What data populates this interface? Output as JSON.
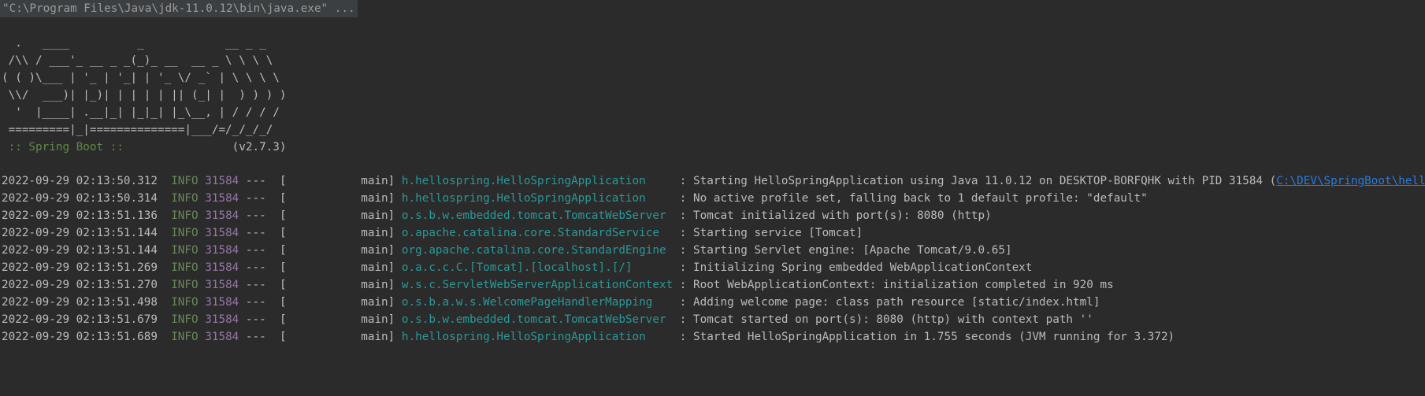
{
  "console": {
    "command": "\"C:\\Program Files\\Java\\jdk-11.0.12\\bin\\java.exe\" ...",
    "banner": [
      "  .   ____          _            __ _ _",
      " /\\\\ / ___'_ __ _ _(_)_ __  __ _ \\ \\ \\ \\",
      "( ( )\\___ | '_ | '_| | '_ \\/ _` | \\ \\ \\ \\",
      " \\\\/  ___)| |_)| | | | | || (_| |  ) ) ) )",
      "  '  |____| .__|_| |_|_| |_\\__, | / / / /",
      " =========|_|==============|___/=/_/_/_/"
    ],
    "spring_label": " :: Spring Boot :: ",
    "spring_version": "               (v2.7.3)",
    "log_entries": [
      {
        "timestamp": "2022-09-29 02:13:50.312",
        "level": "INFO",
        "pid": "31584",
        "thread": "---  [           main]",
        "logger": "h.hellospring.HelloSpringApplication    ",
        "message": " : Starting HelloSpringApplication using Java 11.0.12 on DESKTOP-BORFQHK with PID 31584 (",
        "link": "C:\\DEV\\SpringBoot\\hello-spring\\out\\prod"
      },
      {
        "timestamp": "2022-09-29 02:13:50.314",
        "level": "INFO",
        "pid": "31584",
        "thread": "---  [           main]",
        "logger": "h.hellospring.HelloSpringApplication    ",
        "message": " : No active profile set, falling back to 1 default profile: \"default\"",
        "link": ""
      },
      {
        "timestamp": "2022-09-29 02:13:51.136",
        "level": "INFO",
        "pid": "31584",
        "thread": "---  [           main]",
        "logger": "o.s.b.w.embedded.tomcat.TomcatWebServer ",
        "message": " : Tomcat initialized with port(s): 8080 (http)",
        "link": ""
      },
      {
        "timestamp": "2022-09-29 02:13:51.144",
        "level": "INFO",
        "pid": "31584",
        "thread": "---  [           main]",
        "logger": "o.apache.catalina.core.StandardService  ",
        "message": " : Starting service [Tomcat]",
        "link": ""
      },
      {
        "timestamp": "2022-09-29 02:13:51.144",
        "level": "INFO",
        "pid": "31584",
        "thread": "---  [           main]",
        "logger": "org.apache.catalina.core.StandardEngine ",
        "message": " : Starting Servlet engine: [Apache Tomcat/9.0.65]",
        "link": ""
      },
      {
        "timestamp": "2022-09-29 02:13:51.269",
        "level": "INFO",
        "pid": "31584",
        "thread": "---  [           main]",
        "logger": "o.a.c.c.C.[Tomcat].[localhost].[/]      ",
        "message": " : Initializing Spring embedded WebApplicationContext",
        "link": ""
      },
      {
        "timestamp": "2022-09-29 02:13:51.270",
        "level": "INFO",
        "pid": "31584",
        "thread": "---  [           main]",
        "logger": "w.s.c.ServletWebServerApplicationContext",
        "message": " : Root WebApplicationContext: initialization completed in 920 ms",
        "link": ""
      },
      {
        "timestamp": "2022-09-29 02:13:51.498",
        "level": "INFO",
        "pid": "31584",
        "thread": "---  [           main]",
        "logger": "o.s.b.a.w.s.WelcomePageHandlerMapping   ",
        "message": " : Adding welcome page: class path resource [static/index.html]",
        "link": ""
      },
      {
        "timestamp": "2022-09-29 02:13:51.679",
        "level": "INFO",
        "pid": "31584",
        "thread": "---  [           main]",
        "logger": "o.s.b.w.embedded.tomcat.TomcatWebServer ",
        "message": " : Tomcat started on port(s): 8080 (http) with context path ''",
        "link": ""
      },
      {
        "timestamp": "2022-09-29 02:13:51.689",
        "level": "INFO",
        "pid": "31584",
        "thread": "---  [           main]",
        "logger": "h.hellospring.HelloSpringApplication    ",
        "message": " : Started HelloSpringApplication in 1.755 seconds (JVM running for 3.372)",
        "link": ""
      }
    ]
  },
  "colors": {
    "background": "#2b2b2b",
    "text": "#bbbbbb",
    "level": "#6a8759",
    "pid": "#9876aa",
    "logger": "#299999",
    "link": "#287bde",
    "spring_label": "#5f8a45"
  }
}
